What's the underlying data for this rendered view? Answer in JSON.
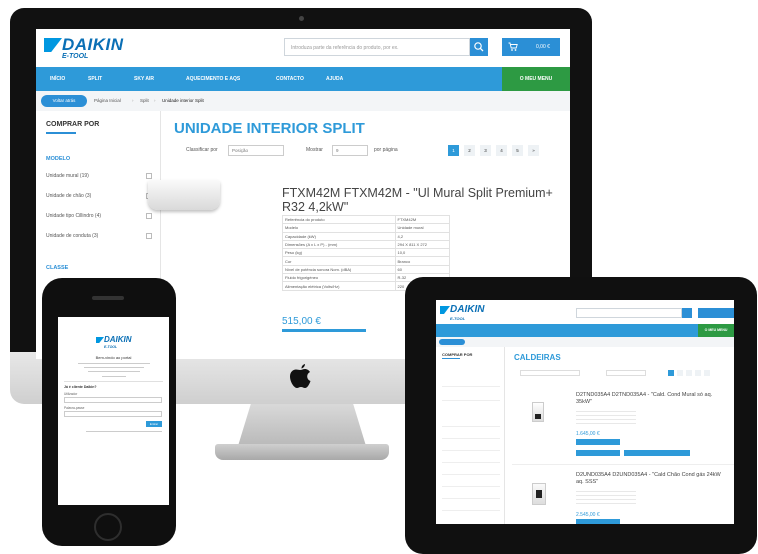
{
  "brand": {
    "name": "DAIKIN",
    "sub": "E-TOOL"
  },
  "colors": {
    "accent": "#2e9ad9",
    "nav_green": "#2d9a43",
    "logo_blue": "#0a6fb5"
  },
  "desktop": {
    "search_placeholder": "Introduza parte da referência do produto, por ex.",
    "cart_label": "0,00 €",
    "nav": [
      "INÍCIO",
      "SPLIT",
      "SKY AIR",
      "AQUECIMENTO E AQS",
      "CONTACTO",
      "AJUDA"
    ],
    "nav_account": "O MEU MENU",
    "breadcrumb_back": "Voltar atrás",
    "breadcrumb": [
      "Página Inicial",
      "Split",
      "Unidade interior Split"
    ],
    "sidebar": {
      "title": "COMPRAR POR",
      "modelo_heading": "MODELO",
      "modelo_items": [
        "Unidade mural (19)",
        "Unidade de chão (3)",
        "Unidade tipo Cillindro (4)",
        "Unidade de conduta (3)"
      ],
      "classe_heading": "CLASSE"
    },
    "page_title": "UNIDADE INTERIOR SPLIT",
    "sort_label": "Classificar por",
    "sort_value": "Posição",
    "show_label": "Mostrar",
    "show_value": "9",
    "per_page": "por página",
    "pages": [
      "1",
      "2",
      "3",
      "4",
      "5",
      "»"
    ],
    "product": {
      "title": "FTXM42M FTXM42M - \"Ul Mural Split Premium+ R32 4,2kW\"",
      "specs": [
        [
          "Referência do produto",
          "FTXM42M"
        ],
        [
          "Modelo",
          "Unidade mural"
        ],
        [
          "Capacidade (kW)",
          "4,2"
        ],
        [
          "Dimensões (A x L x P) - (mm)",
          "294 X 811 X 272"
        ],
        [
          "Peso (kg)",
          "10,0"
        ],
        [
          "Cor",
          "Branco"
        ],
        [
          "Nível de potência sonora Nom. (dBA)",
          "60"
        ],
        [
          "Fluido frigorigéneo",
          "R-32"
        ],
        [
          "Alimentação elétrica (Volts/Hz)",
          "220"
        ]
      ],
      "price": "515,00 €"
    }
  },
  "phone": {
    "title": "Bem-vindo ao portal",
    "login_heading": "Já é cliente Daikin?",
    "user_label": "Utilizador",
    "password_label": "Palavra-passe",
    "login_button": "Entrar"
  },
  "tablet": {
    "page_title": "CALDEIRAS",
    "sidebar_title": "COMPRAR POR",
    "nav_account": "O MEU MENU",
    "products": [
      {
        "title": "D2TND035A4 D2TND035A4 - \"Cald. Cond Mural só aq. 35kW\"",
        "price": "1.645,00 €"
      },
      {
        "title": "D2UND035A4 D2UND035A4 - \"Cald Chão Cond gás 24kW aq. SSS\"",
        "price": "2.545,00 €"
      }
    ]
  }
}
